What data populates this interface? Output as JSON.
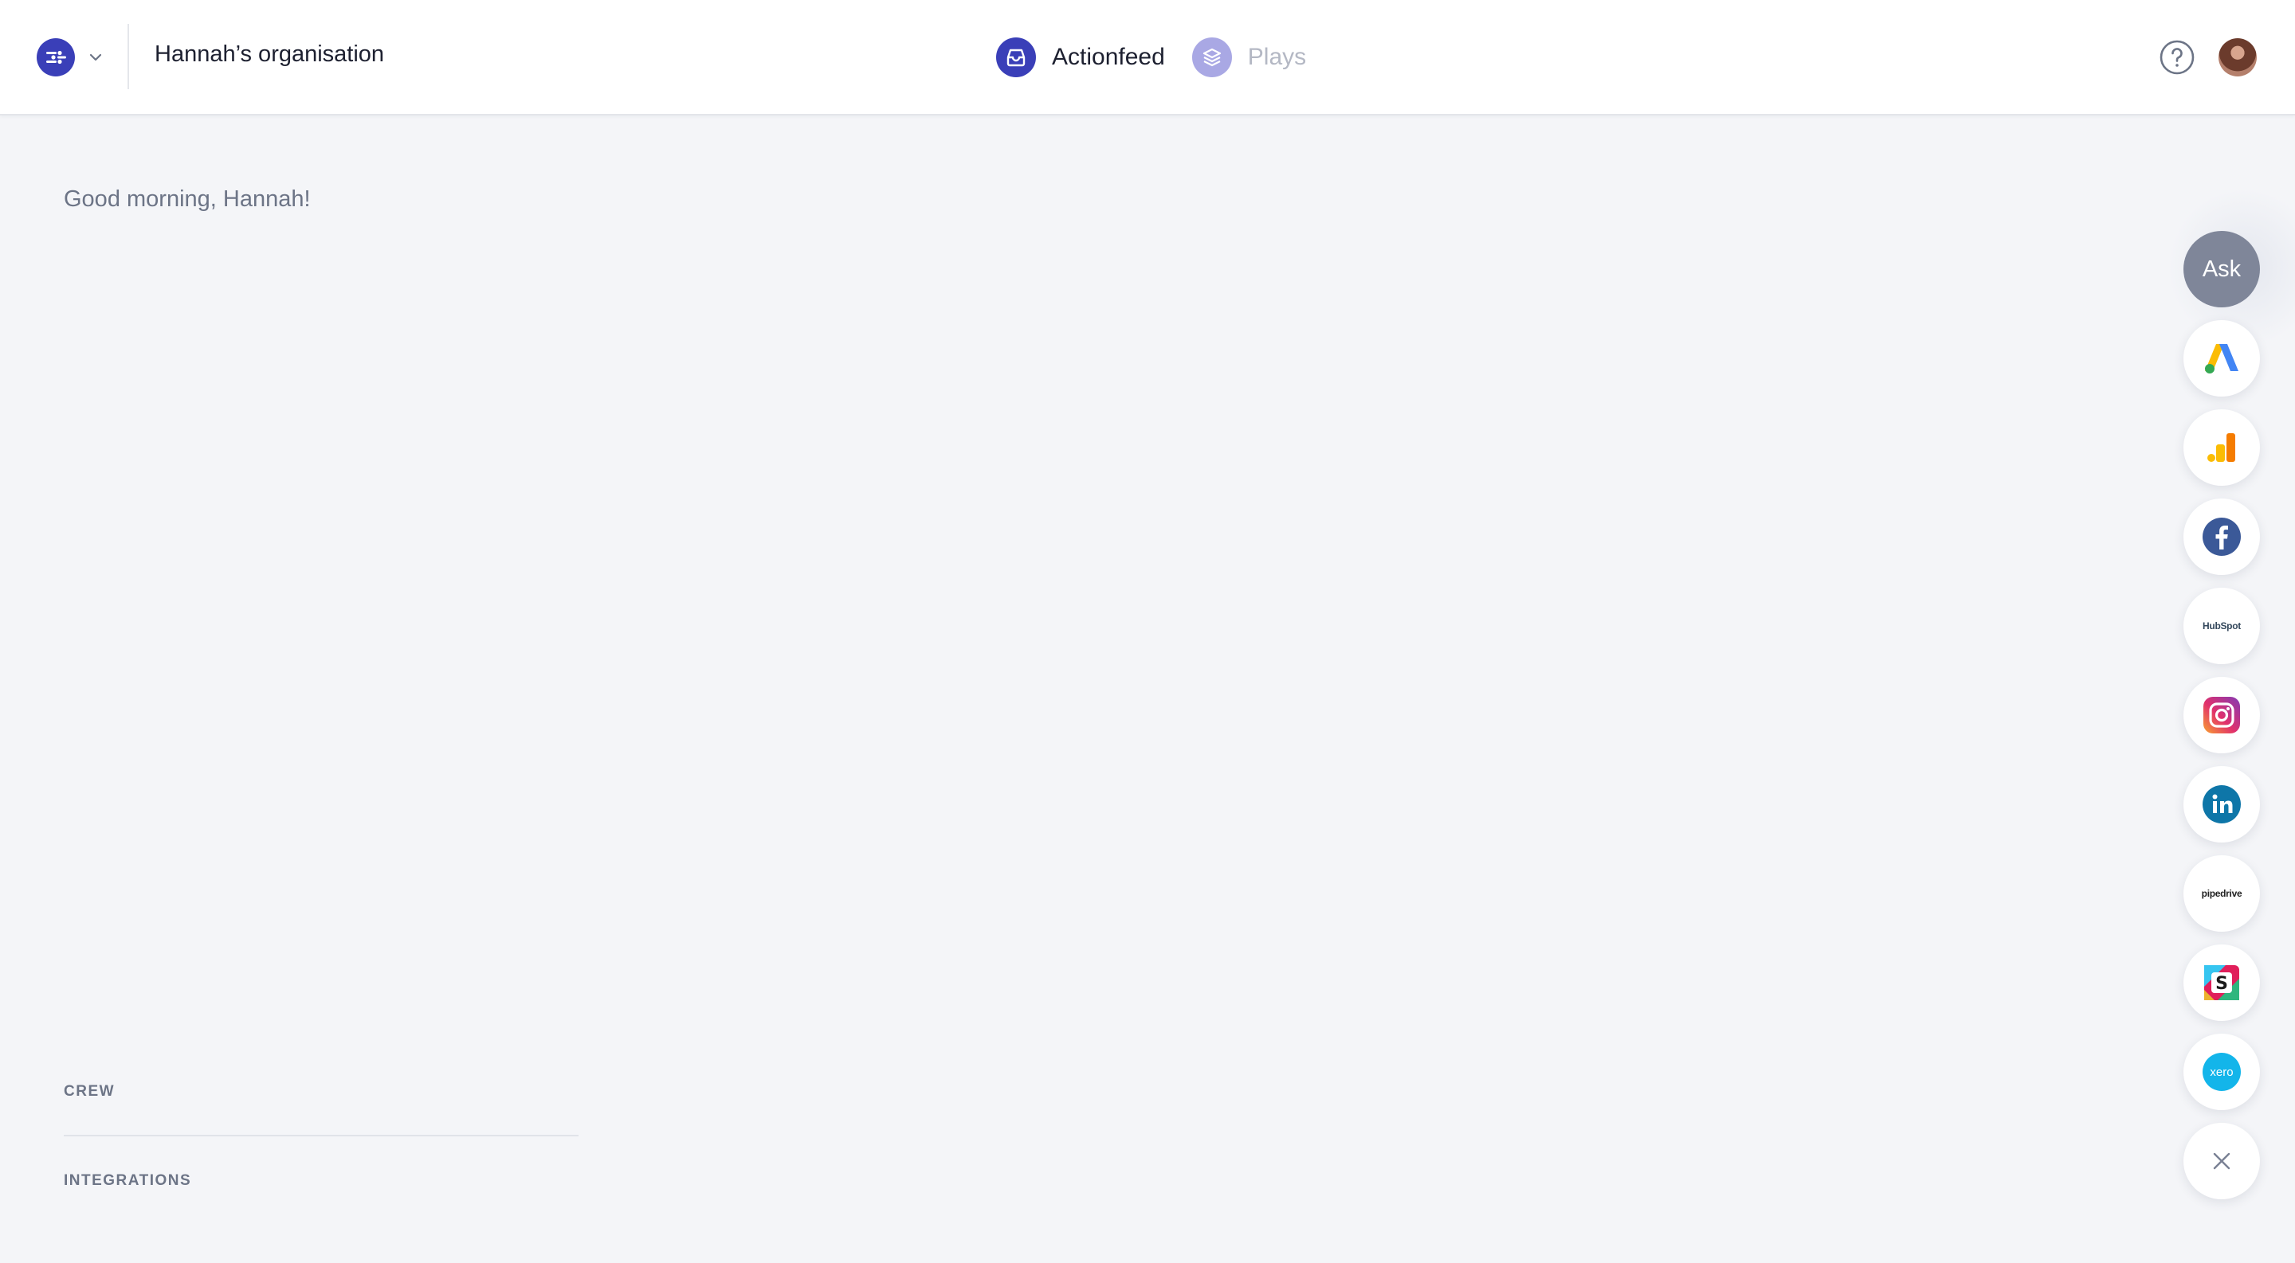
{
  "header": {
    "org_name": "Hannah’s organisation",
    "nav": [
      {
        "label": "Actionfeed",
        "icon": "inbox-icon",
        "active": true
      },
      {
        "label": "Plays",
        "icon": "layers-icon",
        "active": false
      }
    ],
    "help_icon": "question-circle-icon",
    "accent_color": "#3a3fb8"
  },
  "main": {
    "greeting": "Good morning, Hannah!",
    "sections": [
      "CREW",
      "INTEGRATIONS"
    ]
  },
  "integrations_rail": {
    "ask_label": "Ask",
    "items": [
      {
        "icon": "google-ads-icon"
      },
      {
        "icon": "google-analytics-icon"
      },
      {
        "icon": "facebook-icon"
      },
      {
        "icon": "hubspot-icon",
        "wordmark": "HubSpot"
      },
      {
        "icon": "instagram-icon"
      },
      {
        "icon": "linkedin-icon"
      },
      {
        "icon": "pipedrive-icon",
        "wordmark": "pipedrive"
      },
      {
        "icon": "slack-icon"
      },
      {
        "icon": "xero-icon",
        "wordmark": "xero"
      }
    ],
    "close_icon": "close-icon"
  }
}
